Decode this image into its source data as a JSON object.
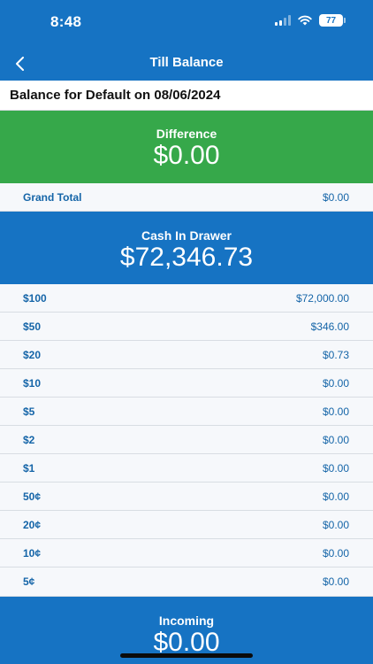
{
  "status_bar": {
    "time": "8:48",
    "battery": "77"
  },
  "nav": {
    "title": "Till Balance"
  },
  "balance_for": "Balance for Default on 08/06/2024",
  "difference": {
    "label": "Difference",
    "value": "$0.00"
  },
  "grand_total": {
    "label": "Grand Total",
    "value": "$0.00"
  },
  "cash_in_drawer": {
    "label": "Cash In Drawer",
    "value": "$72,346.73"
  },
  "denominations": [
    {
      "label": "$100",
      "value": "$72,000.00"
    },
    {
      "label": "$50",
      "value": "$346.00"
    },
    {
      "label": "$20",
      "value": "$0.73"
    },
    {
      "label": "$10",
      "value": "$0.00"
    },
    {
      "label": "$5",
      "value": "$0.00"
    },
    {
      "label": "$2",
      "value": "$0.00"
    },
    {
      "label": "$1",
      "value": "$0.00"
    },
    {
      "label": "50¢",
      "value": "$0.00"
    },
    {
      "label": "20¢",
      "value": "$0.00"
    },
    {
      "label": "10¢",
      "value": "$0.00"
    },
    {
      "label": "5¢",
      "value": "$0.00"
    }
  ],
  "incoming": {
    "label": "Incoming",
    "value": "$0.00"
  },
  "icons": {
    "back": "chevron-left-icon",
    "signal": "cellular-signal-icon",
    "wifi": "wifi-icon",
    "battery": "battery-icon"
  }
}
